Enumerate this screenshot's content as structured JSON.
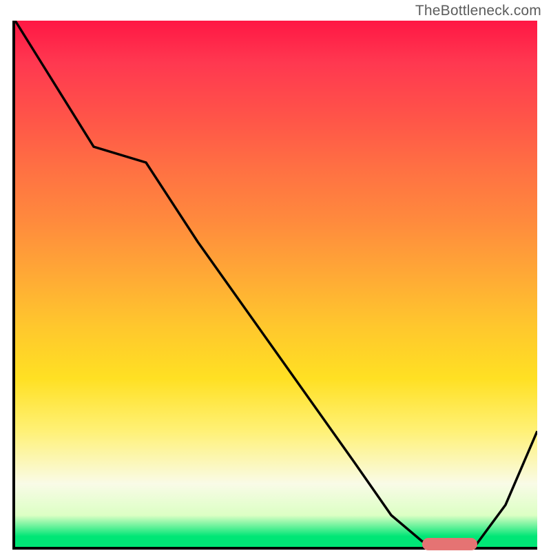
{
  "watermark": "TheBottleneck.com",
  "chart_data": {
    "type": "line",
    "title": "",
    "xlabel": "",
    "ylabel": "",
    "xlim": [
      0,
      100
    ],
    "ylim": [
      0,
      100
    ],
    "x": [
      0,
      5,
      15,
      25,
      35,
      45,
      55,
      65,
      72,
      78,
      82,
      88,
      94,
      100
    ],
    "values": [
      100,
      92,
      76,
      73,
      58,
      44,
      30,
      16,
      6,
      1,
      0,
      0,
      8,
      22
    ],
    "marker": {
      "x_start": 78,
      "x_end": 88,
      "y": 0
    },
    "background": "vertical-heat-gradient",
    "gradient_colors": [
      "#ff1744",
      "#ffc72d",
      "#fff176",
      "#00e676"
    ]
  }
}
